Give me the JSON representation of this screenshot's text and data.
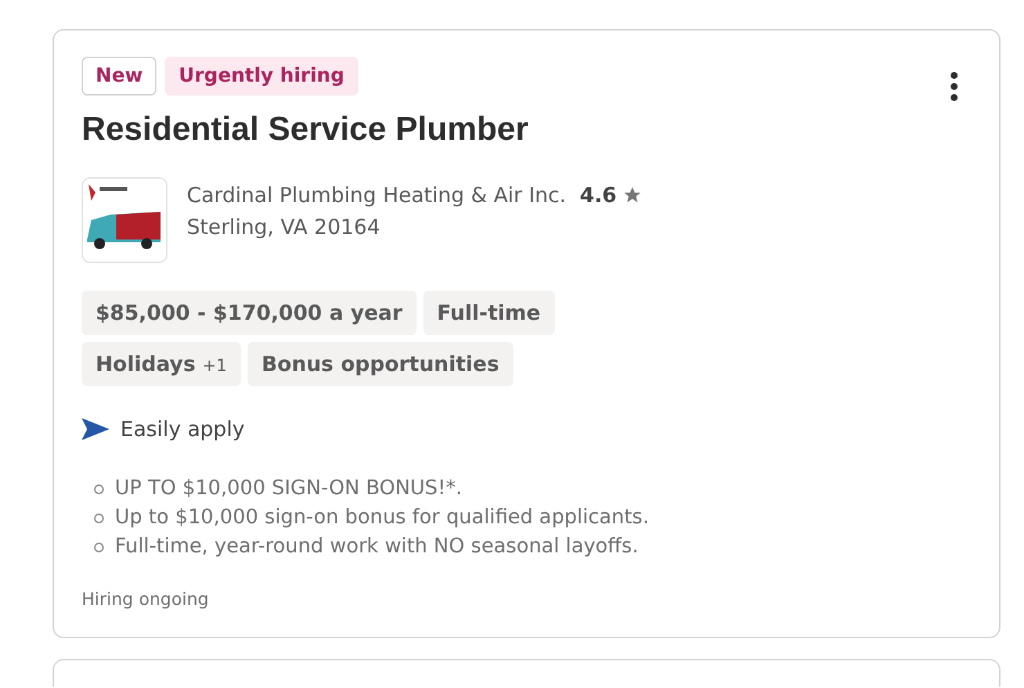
{
  "job_card": {
    "tags": [
      {
        "label": "New",
        "kind": "outline"
      },
      {
        "label": "Urgently hiring",
        "kind": "filled"
      }
    ],
    "title": "Residential Service Plumber",
    "company": {
      "name": "Cardinal Plumbing Heating & Air Inc.",
      "rating": "4.6",
      "location": "Sterling, VA 20164"
    },
    "attributes": [
      {
        "label": "$85,000 - $170,000 a year"
      },
      {
        "label": "Full-time"
      },
      {
        "label": "Holidays",
        "extra": "+1"
      },
      {
        "label": "Bonus opportunities"
      }
    ],
    "easily_apply": "Easily apply",
    "snippets": [
      "UP TO $10,000 SIGN-ON BONUS!*.",
      "Up to $10,000 sign-on bonus for qualified applicants.",
      "Full-time, year-round work with NO seasonal layoffs."
    ],
    "footer": "Hiring ongoing"
  }
}
